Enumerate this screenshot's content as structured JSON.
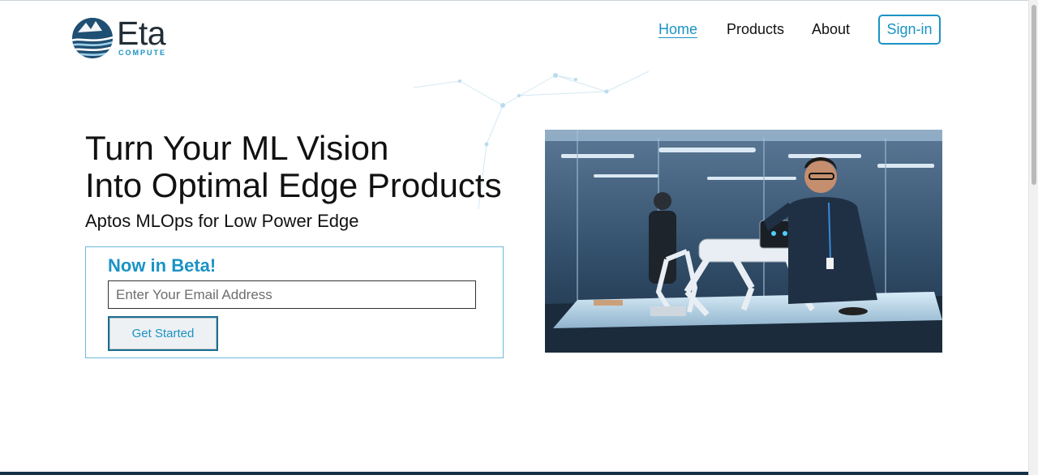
{
  "brand": {
    "name": "Eta",
    "subname": "COMPUTE"
  },
  "nav": {
    "items": [
      {
        "label": "Home",
        "active": true
      },
      {
        "label": "Products",
        "active": false
      },
      {
        "label": "About",
        "active": false
      }
    ],
    "signin_label": "Sign-in"
  },
  "hero": {
    "title_line1": "Turn Your ML Vision",
    "title_line2": "Into Optimal Edge Products",
    "subtitle": "Aptos MLOps for Low Power Edge"
  },
  "signup": {
    "badge": "Now in Beta!",
    "email_placeholder": "Enter Your Email Address",
    "email_value": "",
    "button_label": "Get Started"
  },
  "colors": {
    "accent": "#1a93c4",
    "text": "#111111",
    "footer": "#16324a"
  },
  "image": {
    "subject": "engineer with robotic dog in lab"
  }
}
